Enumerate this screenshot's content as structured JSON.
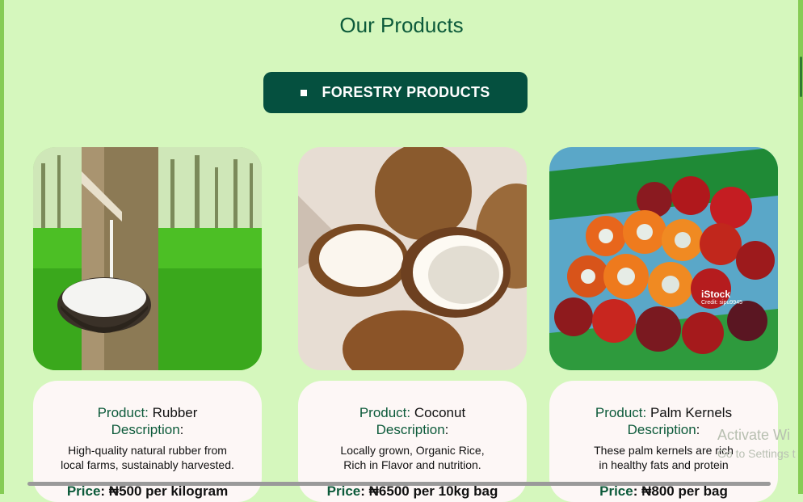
{
  "page": {
    "title": "Our Products",
    "category_button": "FORESTRY PRODUCTS"
  },
  "labels": {
    "product": "Product:",
    "description": "Description",
    "description_colon": ":",
    "price": "Price"
  },
  "products": [
    {
      "name": "Rubber",
      "description_line1": "High-quality natural rubber from",
      "description_line2": "local farms, sustainably harvested.",
      "price_value": ": ₦500 per kilogram",
      "image_icon": "rubber-tapping-image"
    },
    {
      "name": "Coconut",
      "description_line1": "Locally grown, Organic Rice,",
      "description_line2": "Rich in Flavor and nutrition.",
      "price_value": ": ₦6500 per 10kg bag",
      "image_icon": "coconut-image"
    },
    {
      "name": "Palm Kernels",
      "description_line1": "These palm kernels are rich",
      "description_line2": "in healthy fats and protein",
      "price_value": ": ₦800 per bag",
      "image_icon": "palm-kernels-image",
      "image_credit_brand": "iStock",
      "image_credit_text": "Credit: sipu9945"
    }
  ],
  "overlay": {
    "watermark_line1": "Activate Wi",
    "watermark_line2": "Go to Settings t"
  },
  "colors": {
    "background": "#d5f7bd",
    "accent_dark": "#05503f",
    "heading_green": "#0c5a3a",
    "card_bg": "#fdf7f6"
  }
}
